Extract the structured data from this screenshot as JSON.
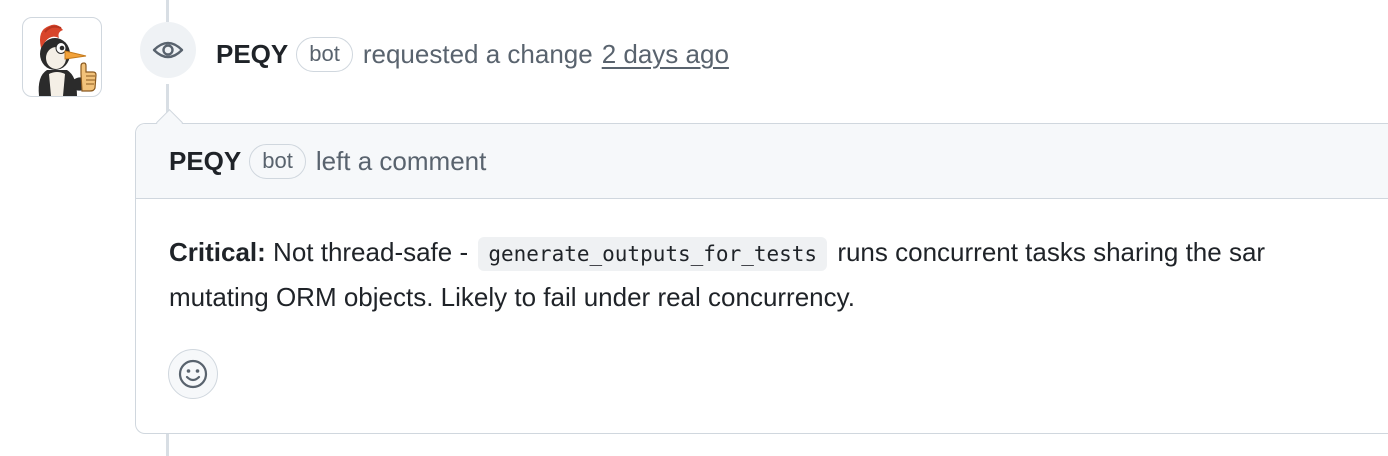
{
  "event": {
    "author": "PEQY",
    "badge": "bot",
    "action": "requested a change",
    "time": "2 days ago",
    "icon": "eye-icon"
  },
  "comment": {
    "author": "PEQY",
    "badge": "bot",
    "action": "left a comment",
    "body": {
      "label": "Critical:",
      "text_before": " Not thread-safe - ",
      "code": "generate_outputs_for_tests",
      "text_after": " runs concurrent tasks sharing the sar",
      "line2": "mutating ORM objects. Likely to fail under real concurrency."
    },
    "reaction_icon": "smiley-icon"
  },
  "colors": {
    "border": "#d0d7de",
    "header_bg": "#f6f8fa",
    "muted_text": "#59636e",
    "text": "#1f2328"
  }
}
